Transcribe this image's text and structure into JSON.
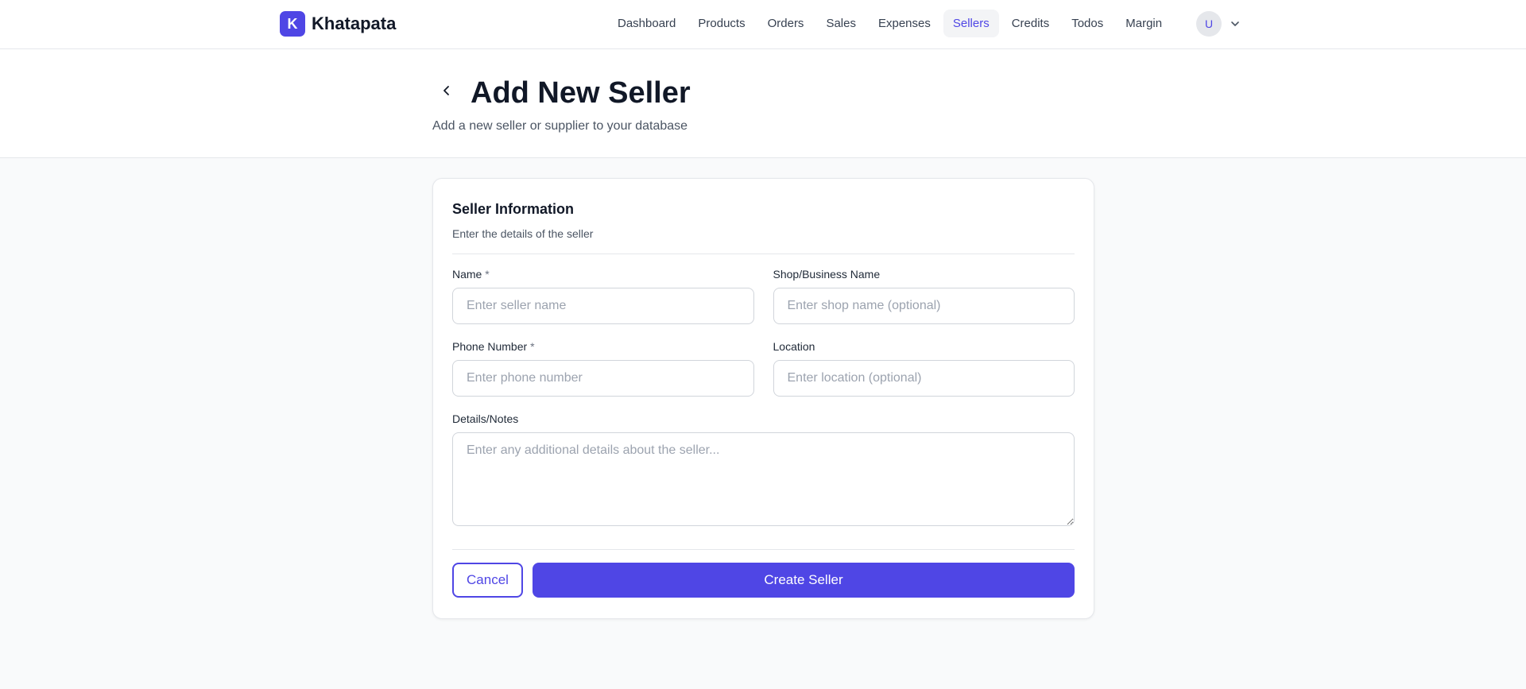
{
  "brand": {
    "logo_letter": "K",
    "name": "Khatapata",
    "accent": "#4f46e5"
  },
  "nav": {
    "items": [
      {
        "label": "Dashboard"
      },
      {
        "label": "Products"
      },
      {
        "label": "Orders"
      },
      {
        "label": "Sales"
      },
      {
        "label": "Expenses"
      },
      {
        "label": "Sellers",
        "active": true
      },
      {
        "label": "Credits"
      },
      {
        "label": "Todos"
      },
      {
        "label": "Margin"
      }
    ]
  },
  "user": {
    "initial": "U",
    "menu_icon": "chevron-down-icon"
  },
  "header": {
    "back_icon": "chevron-left-icon",
    "title": "Add New Seller",
    "subtitle": "Add a new seller or supplier to your database"
  },
  "form": {
    "title": "Seller Information",
    "subtitle": "Enter the details of the seller",
    "name": {
      "label": "Name",
      "required": "*",
      "placeholder": "Enter seller name",
      "value": ""
    },
    "shop": {
      "label": "Shop/Business Name",
      "placeholder": "Enter shop name (optional)",
      "value": ""
    },
    "phone": {
      "label": "Phone Number",
      "required": "*",
      "placeholder": "Enter phone number",
      "value": ""
    },
    "location": {
      "label": "Location",
      "placeholder": "Enter location (optional)",
      "value": ""
    },
    "notes": {
      "label": "Details/Notes",
      "placeholder": "Enter any additional details about the seller...",
      "value": ""
    },
    "cancel_label": "Cancel",
    "submit_label": "Create Seller"
  }
}
